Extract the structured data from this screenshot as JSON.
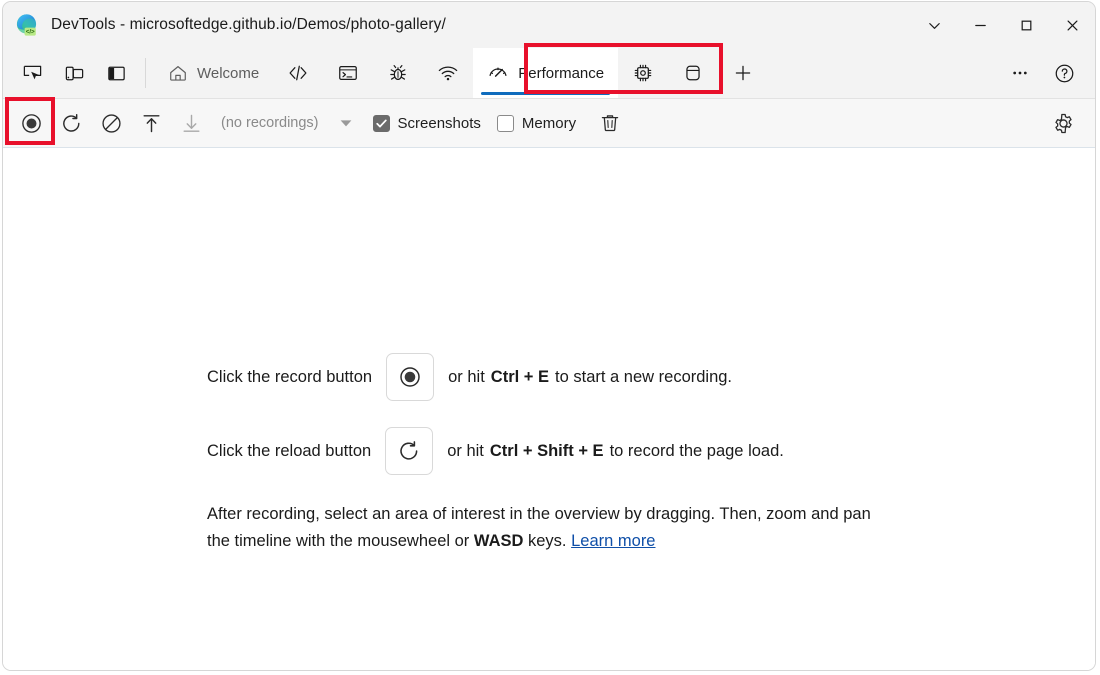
{
  "window": {
    "title": "DevTools - microsoftedge.github.io/Demos/photo-gallery/",
    "logo_icon": "edge-devtools-logo-icon",
    "controls": [
      {
        "name": "customize-dropdown-button",
        "icon": "chevron-down-icon",
        "label": ""
      },
      {
        "name": "minimize-button",
        "icon": "minimize-icon",
        "label": ""
      },
      {
        "name": "maximize-button",
        "icon": "maximize-icon",
        "label": ""
      },
      {
        "name": "close-button",
        "icon": "close-icon",
        "label": ""
      }
    ]
  },
  "toolbar": {
    "left_tools": [
      {
        "name": "inspect-element-button",
        "icon": "inspect-cursor-icon",
        "tooltip": "Inspect"
      },
      {
        "name": "device-emulation-button",
        "icon": "device-toolbar-icon",
        "tooltip": "Toggle device emulation"
      },
      {
        "name": "dock-side-button",
        "icon": "dock-panel-icon",
        "tooltip": "Dock side"
      }
    ],
    "tabs": [
      {
        "name": "tab-welcome",
        "label": "Welcome",
        "icon": "home-icon",
        "active": false
      },
      {
        "name": "tab-elements",
        "label": "",
        "icon": "code-brackets-icon",
        "active": false
      },
      {
        "name": "tab-console",
        "label": "",
        "icon": "console-terminal-icon",
        "active": false
      },
      {
        "name": "tab-sources",
        "label": "",
        "icon": "bug-icon",
        "active": false
      },
      {
        "name": "tab-network",
        "label": "",
        "icon": "network-wifi-icon",
        "active": false
      },
      {
        "name": "tab-performance",
        "label": "Performance",
        "icon": "performance-gauge-icon",
        "active": true
      },
      {
        "name": "tab-memory",
        "label": "",
        "icon": "memory-chip-icon",
        "active": false
      },
      {
        "name": "tab-application",
        "label": "",
        "icon": "application-database-icon",
        "active": false
      },
      {
        "name": "tab-add",
        "label": "",
        "icon": "plus-icon",
        "active": false
      }
    ],
    "right_tools": [
      {
        "name": "more-tools-button",
        "icon": "ellipsis-icon"
      },
      {
        "name": "help-button",
        "icon": "help-circle-icon"
      }
    ],
    "active_tab_underline_color": "#0f6cbd"
  },
  "perf_toolbar": {
    "record_button": {
      "name": "record-button",
      "icon": "record-circle-icon",
      "tooltip": "Record"
    },
    "reload_button": {
      "name": "reload-record-button",
      "icon": "reload-circular-arrow-icon",
      "tooltip": "Record and reload"
    },
    "clear_button": {
      "name": "clear-button",
      "icon": "clear-circle-slash-icon",
      "tooltip": "Clear"
    },
    "load_button": {
      "name": "load-profile-button",
      "icon": "upload-arrow-icon",
      "tooltip": "Load profile"
    },
    "save_button": {
      "name": "save-profile-button",
      "icon": "download-arrow-icon",
      "tooltip": "Save profile",
      "disabled": true
    },
    "recordings_label": "(no recordings)",
    "recordings_caret": "triangle-down-icon",
    "screenshots": {
      "label": "Screenshots",
      "checked": true
    },
    "memory": {
      "label": "Memory",
      "checked": false
    },
    "delete_button": {
      "name": "delete-recording-button",
      "icon": "trash-icon"
    },
    "settings_button": {
      "name": "capture-settings-button",
      "icon": "gear-icon"
    }
  },
  "annotations": {
    "color": "#e8102b",
    "boxes": [
      {
        "name": "annotation-performance-tab",
        "target": "tab-performance"
      },
      {
        "name": "annotation-record-button",
        "target": "record-button"
      }
    ]
  },
  "landing": {
    "row1": {
      "before": "Click the record button",
      "icon": "record-circle-icon",
      "after_before_key": "or hit",
      "shortcut": "Ctrl + E",
      "after": "to start a new recording."
    },
    "row2": {
      "before": "Click the reload button",
      "icon": "reload-circular-arrow-icon",
      "after_before_key": "or hit",
      "shortcut": "Ctrl + Shift + E",
      "after": "to record the page load."
    },
    "paragraph": {
      "part1": "After recording, select an area of interest in the overview by dragging. Then, zoom and pan the timeline with the mousewheel or",
      "keys": "WASD",
      "part2": "keys.",
      "link": "Learn more"
    }
  }
}
